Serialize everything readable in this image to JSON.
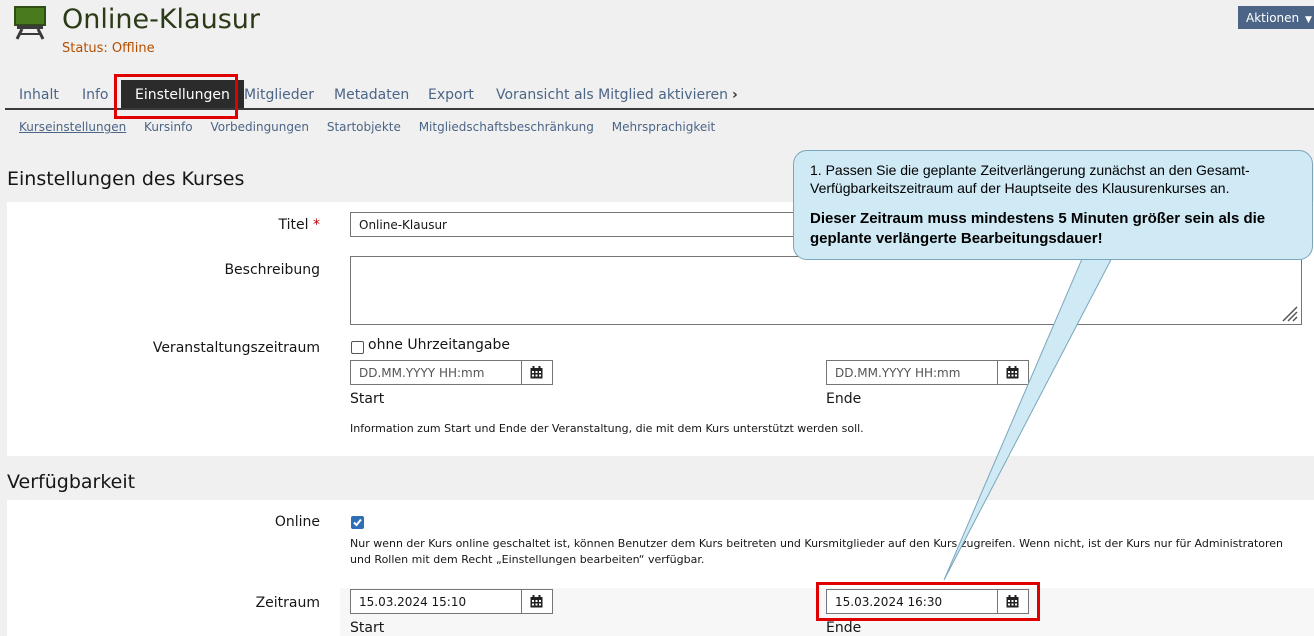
{
  "header": {
    "title": "Online-Klausur",
    "status": "Status: Offline",
    "actions_label": "Aktionen"
  },
  "tabs": [
    {
      "label": "Inhalt"
    },
    {
      "label": "Info"
    },
    {
      "label": "Einstellungen"
    },
    {
      "label": "Mitglieder"
    },
    {
      "label": "Metadaten"
    },
    {
      "label": "Export"
    },
    {
      "label": "Voransicht als Mitglied aktivieren"
    }
  ],
  "subtabs": [
    {
      "label": "Kurseinstellungen"
    },
    {
      "label": "Kursinfo"
    },
    {
      "label": "Vorbedingungen"
    },
    {
      "label": "Startobjekte"
    },
    {
      "label": "Mitgliedschaftsbeschränkung"
    },
    {
      "label": "Mehrsprachigkeit"
    }
  ],
  "course_settings": {
    "section_title": "Einstellungen des Kurses",
    "title_label": "Titel",
    "required_mark": "*",
    "title_value": "Online-Klausur",
    "description_label": "Beschreibung",
    "description_value": "",
    "period_label": "Veranstaltungszeitraum",
    "no_time_label": "ohne Uhrzeitangabe",
    "date_placeholder": "DD.MM.YYYY HH:mm",
    "start_label": "Start",
    "end_label": "Ende",
    "period_info": "Information zum Start und Ende der Veranstaltung, die mit dem Kurs unterstützt werden soll."
  },
  "availability": {
    "section_title": "Verfügbarkeit",
    "online_label": "Online",
    "online_checked": true,
    "online_info": "Nur wenn der Kurs online geschaltet ist, können Benutzer dem Kurs beitreten und Kursmitglieder auf den Kurs zugreifen. Wenn nicht, ist der Kurs nur für Administratoren und Rollen mit dem Recht „Einstellungen bearbeiten“ verfügbar.",
    "period_label": "Zeitraum",
    "start_value": "15.03.2024 15:10",
    "end_value": "15.03.2024 16:30",
    "start_label": "Start",
    "end_label": "Ende"
  },
  "callout": {
    "line1": "1. Passen Sie die geplante Zeitverlängerung zunächst an den Gesamt-Verfügbarkeitszeitraum auf der Hauptseite des Klausurenkurses an.",
    "line2": "Dieser Zeitraum muss mindestens 5 Minuten größer sein als die geplante verlängerte Bearbeitungsdauer!"
  },
  "icons": {
    "course": "course-board-icon",
    "calendar": "calendar-icon",
    "chevron": "chevron-right-icon",
    "caret": "caret-down-icon"
  },
  "colors": {
    "link": "#4c6586",
    "status": "#b54f00",
    "title": "#2b3a17",
    "highlight": "#e00000",
    "callout_bg": "#cfe9f5"
  }
}
